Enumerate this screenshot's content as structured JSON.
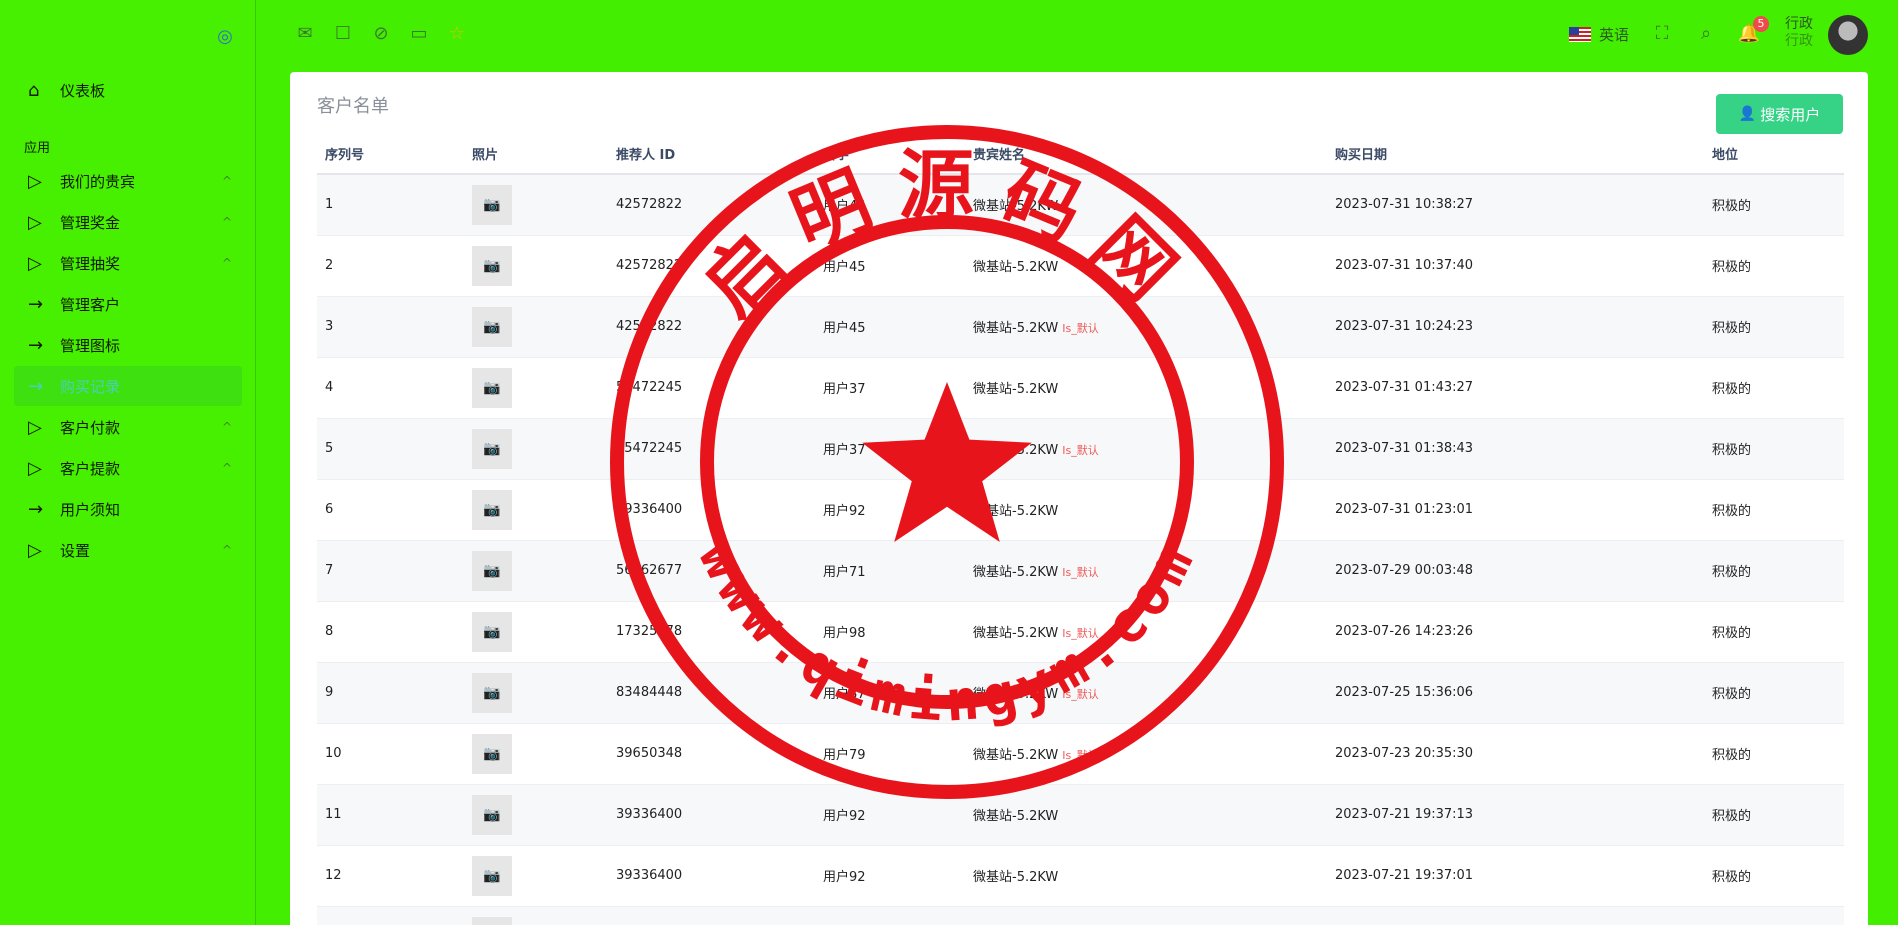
{
  "sidebar": {
    "dashboard": "仪表板",
    "section": "应用",
    "items": [
      {
        "label": "我们的贵宾",
        "icon": "play-icon",
        "chev": true
      },
      {
        "label": "管理奖金",
        "icon": "play-icon",
        "chev": true
      },
      {
        "label": "管理抽奖",
        "icon": "play-icon",
        "chev": true
      },
      {
        "label": "管理客户",
        "icon": "arrow-right-icon",
        "chev": false
      },
      {
        "label": "管理图标",
        "icon": "arrow-right-icon",
        "chev": false
      },
      {
        "label": "购买记录",
        "icon": "arrow-right-icon",
        "chev": false,
        "active": true
      },
      {
        "label": "客户付款",
        "icon": "play-icon",
        "chev": true
      },
      {
        "label": "客户提款",
        "icon": "play-icon",
        "chev": true
      },
      {
        "label": "用户须知",
        "icon": "arrow-right-icon",
        "chev": false
      },
      {
        "label": "设置",
        "icon": "play-icon",
        "chev": true
      }
    ]
  },
  "topbar": {
    "language": "英语",
    "notification_count": "5",
    "user_name": "行政",
    "user_role": "行政"
  },
  "card": {
    "title": "客户名单",
    "search_button": "搜索用户"
  },
  "table": {
    "columns": [
      "序列号",
      "照片",
      "推荐人 ID",
      "名字",
      "贵宾姓名",
      "购买日期",
      "地位"
    ],
    "rows": [
      {
        "id": "1",
        "ref": "42572822",
        "name": "用户45",
        "vip": "微基站-5.2KW",
        "tag": "",
        "date": "2023-07-31 10:38:27",
        "status": "积极的"
      },
      {
        "id": "2",
        "ref": "42572822",
        "name": "用户45",
        "vip": "微基站-5.2KW",
        "tag": "",
        "date": "2023-07-31 10:37:40",
        "status": "积极的"
      },
      {
        "id": "3",
        "ref": "42572822",
        "name": "用户45",
        "vip": "微基站-5.2KW",
        "tag": "Is_默认",
        "date": "2023-07-31 10:24:23",
        "status": "积极的"
      },
      {
        "id": "4",
        "ref": "55472245",
        "name": "用户37",
        "vip": "微基站-5.2KW",
        "tag": "",
        "date": "2023-07-31 01:43:27",
        "status": "积极的"
      },
      {
        "id": "5",
        "ref": "55472245",
        "name": "用户37",
        "vip": "微基站-5.2KW",
        "tag": "Is_默认",
        "date": "2023-07-31 01:38:43",
        "status": "积极的"
      },
      {
        "id": "6",
        "ref": "39336400",
        "name": "用户92",
        "vip": "微基站-5.2KW",
        "tag": "",
        "date": "2023-07-31 01:23:01",
        "status": "积极的"
      },
      {
        "id": "7",
        "ref": "56562677",
        "name": "用户71",
        "vip": "微基站-5.2KW",
        "tag": "Is_默认",
        "date": "2023-07-29 00:03:48",
        "status": "积极的"
      },
      {
        "id": "8",
        "ref": "17325178",
        "name": "用户98",
        "vip": "微基站-5.2KW",
        "tag": "Is_默认",
        "date": "2023-07-26 14:23:26",
        "status": "积极的"
      },
      {
        "id": "9",
        "ref": "83484448",
        "name": "用户87",
        "vip": "微基站-5.2KW",
        "tag": "Is_默认",
        "date": "2023-07-25 15:36:06",
        "status": "积极的"
      },
      {
        "id": "10",
        "ref": "39650348",
        "name": "用户79",
        "vip": "微基站-5.2KW",
        "tag": "Is_默认",
        "date": "2023-07-23 20:35:30",
        "status": "积极的"
      },
      {
        "id": "11",
        "ref": "39336400",
        "name": "用户92",
        "vip": "微基站-5.2KW",
        "tag": "",
        "date": "2023-07-21 19:37:13",
        "status": "积极的"
      },
      {
        "id": "12",
        "ref": "39336400",
        "name": "用户92",
        "vip": "微基站-5.2KW",
        "tag": "",
        "date": "2023-07-21 19:37:01",
        "status": "积极的"
      },
      {
        "id": "",
        "ref": "",
        "name": "",
        "vip": "",
        "tag": "",
        "date": "",
        "status": ""
      }
    ]
  },
  "watermark": {
    "top_text": "启明源码网",
    "bottom_text": "www.qimingym.com"
  },
  "colors": {
    "background": "#44ee00",
    "accent": "#36d286",
    "tag": "#f05a5a",
    "seal": "#e8141c"
  }
}
